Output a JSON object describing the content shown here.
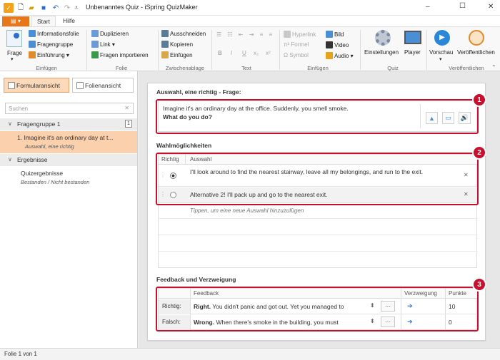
{
  "window": {
    "title": "Unbenanntes Quiz - iSpring QuizMaker",
    "minimize": "–",
    "maximize": "☐",
    "close": "✕"
  },
  "ribbon_tabs": {
    "file": "▤ ▾",
    "start": "Start",
    "help": "Hilfe"
  },
  "ribbon": {
    "frage": "Frage",
    "informationsfolie": "Informationsfolie",
    "fragengruppe": "Fragengruppe",
    "einfuehrung": "Einführung ▾",
    "group_einfuegen": "Einfügen",
    "duplizieren": "Duplizieren",
    "link": "Link ▾",
    "fragen_importieren": "Fragen importieren",
    "group_folie": "Folie",
    "ausschneiden": "Ausschneiden",
    "kopieren": "Kopieren",
    "einfuegen": "Einfügen",
    "group_zwischenablage": "Zwischenablage",
    "bold": "B",
    "italic": "I",
    "underline": "U",
    "sub": "x₂",
    "sup": "x²",
    "group_text": "Text",
    "hyperlink": "Hyperlink",
    "formel": "Formel",
    "symbol": "Symbol",
    "bild": "Bild",
    "video": "Video",
    "audio": "Audio ▾",
    "group_einfuegen2": "Einfügen",
    "einstellungen": "Einstellungen",
    "player": "Player",
    "group_quiz": "Quiz",
    "vorschau": "Vorschau",
    "vorschau_arrow": "▾",
    "veroeffentlichen": "Veröffentlichen",
    "group_veroeffentlichen": "Veröffentlichen"
  },
  "left": {
    "formularansicht": "Formularansicht",
    "folienansicht": "Folienansicht",
    "search_placeholder": "Suchen",
    "search_clear": "✕",
    "group1": "Fragengruppe 1",
    "group1_count": "1",
    "caret": "∨",
    "item1_title": "1. Imagine it's an ordinary day at t...",
    "item1_sub": "Auswahl, eine richtig",
    "results": "Ergebnisse",
    "quiz_results": "Quizergebnisse",
    "quiz_results_sub": "Bestanden / Nicht bestanden"
  },
  "editor": {
    "question_header": "Auswahl, eine richtig - Frage:",
    "question_line1": "Imagine it's an ordinary day at the office. Suddenly, you smell smoke.",
    "question_line2": "What do you do?",
    "choices_header": "Wahlmöglichkeiten",
    "col_richtig": "Richtig",
    "col_auswahl": "Auswahl",
    "choice1": "I'll look around to find the nearest stairway, leave all my belongings, and run to the exit.",
    "choice2": "Alternative 2! I'll pack up and go to the nearest exit.",
    "delete": "✕",
    "add_hint": "Tippen, um eine neue Auswahl hinzuzufügen",
    "feedback_header": "Feedback und Verzweigung",
    "col_feedback": "Feedback",
    "col_verzweigung": "Verzweigung",
    "col_punkte": "Punkte",
    "row1_label": "Richtig:",
    "row1_bold": "Right.",
    "row1_text": " You didn't panic and got out. Yet you managed to",
    "row1_points": "10",
    "row2_label": "Falsch:",
    "row2_bold": "Wrong.",
    "row2_text": " When there's smoke in the building, you must",
    "row2_points": "0",
    "more": "···",
    "arrow": "➔",
    "spin": "⬍"
  },
  "badges": {
    "b1": "1",
    "b2": "2",
    "b3": "3"
  },
  "status": "Folie 1 von 1"
}
